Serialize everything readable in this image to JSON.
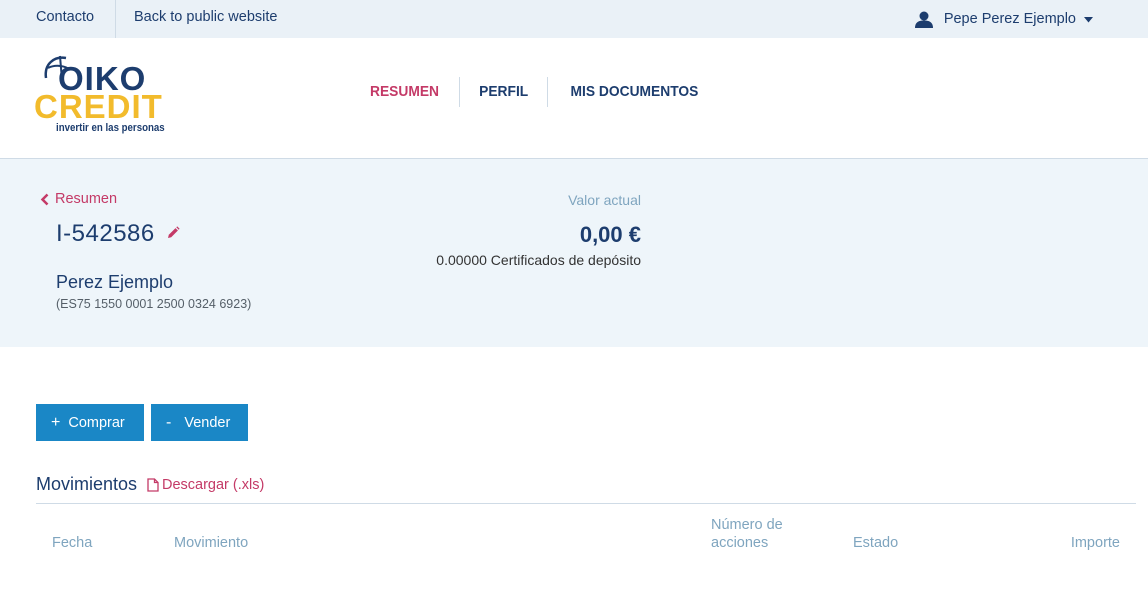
{
  "topbar": {
    "contact": "Contacto",
    "back_public": "Back to public website",
    "user_name": "Pepe Perez Ejemplo"
  },
  "logo": {
    "line1": "OIKO",
    "line2": "CREDIT",
    "tagline": "invertir en las personas"
  },
  "nav": {
    "items": [
      {
        "label": "RESUMEN",
        "active": true
      },
      {
        "label": "PERFIL",
        "active": false
      },
      {
        "label": "MIS DOCUMENTOS",
        "active": false
      }
    ]
  },
  "summary": {
    "back_label": "Resumen",
    "account_id": "I-542586",
    "holder": "Perez Ejemplo",
    "iban": "(ES75 1550 0001 2500 0324 6923)",
    "value_label": "Valor actual",
    "value_amount": "0,00 €",
    "certificates": "0.00000 Certificados de depósito"
  },
  "actions": {
    "buy_symbol": "+",
    "buy_label": "Comprar",
    "sell_symbol": "-",
    "sell_label": "Vender"
  },
  "movements": {
    "title": "Movimientos",
    "download_label": "Descargar (.xls)",
    "columns": [
      "Fecha",
      "Movimiento",
      "Número de acciones",
      "Estado",
      "Importe"
    ]
  },
  "colors": {
    "navy": "#1d3d6e",
    "accent": "#c43a67",
    "button": "#1a87c6",
    "yellow": "#f2bb2c",
    "panel": "#eef5fa"
  }
}
